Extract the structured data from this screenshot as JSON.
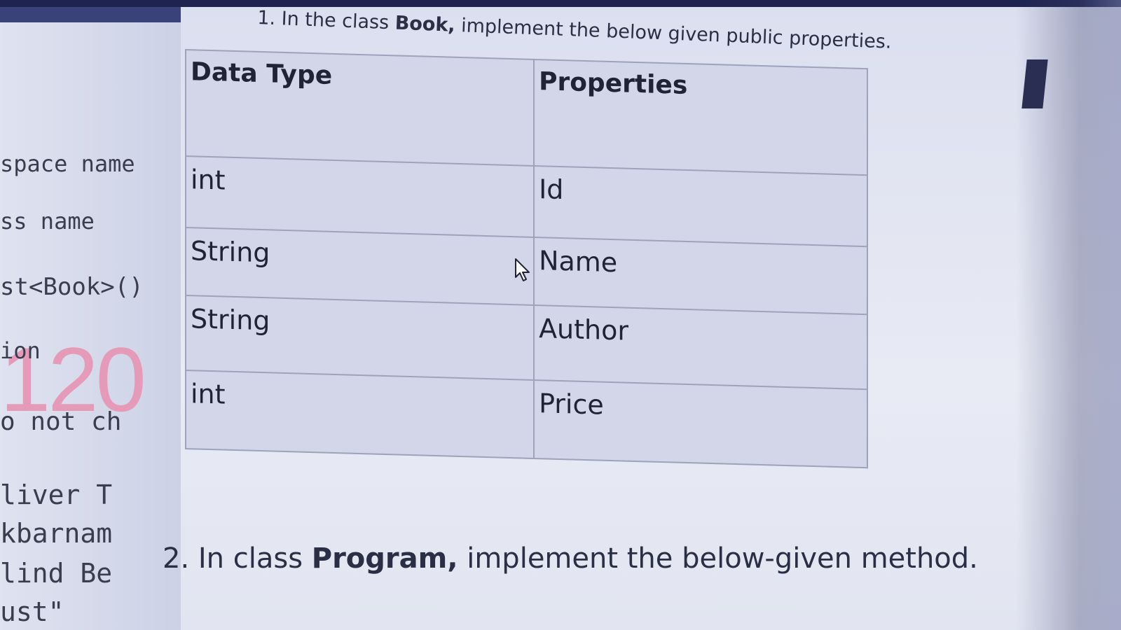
{
  "editor": {
    "lines": [
      "space name",
      "ss name",
      "st<Book>()",
      "ion",
      "o not ch",
      "liver T",
      "kbarnam",
      "lind Be",
      "ust\""
    ],
    "big_number": "120"
  },
  "document": {
    "task1": {
      "prefix": "1. In the class ",
      "bold": "Book,",
      "suffix": " implement the below given public properties."
    },
    "table": {
      "headers": [
        "Data Type",
        "Properties"
      ],
      "rows": [
        [
          "int",
          "Id"
        ],
        [
          "String",
          "Name"
        ],
        [
          "String",
          "Author"
        ],
        [
          "int",
          "Price"
        ]
      ]
    },
    "task2": {
      "prefix": "2. In class ",
      "bold": "Program,",
      "suffix": " implement the below-given method."
    }
  },
  "icons": {
    "cursor": "mouse-pointer-icon"
  },
  "colors": {
    "big_number": "#e59bb8",
    "table_border": "#9ea3bc",
    "text": "#1f2333"
  }
}
